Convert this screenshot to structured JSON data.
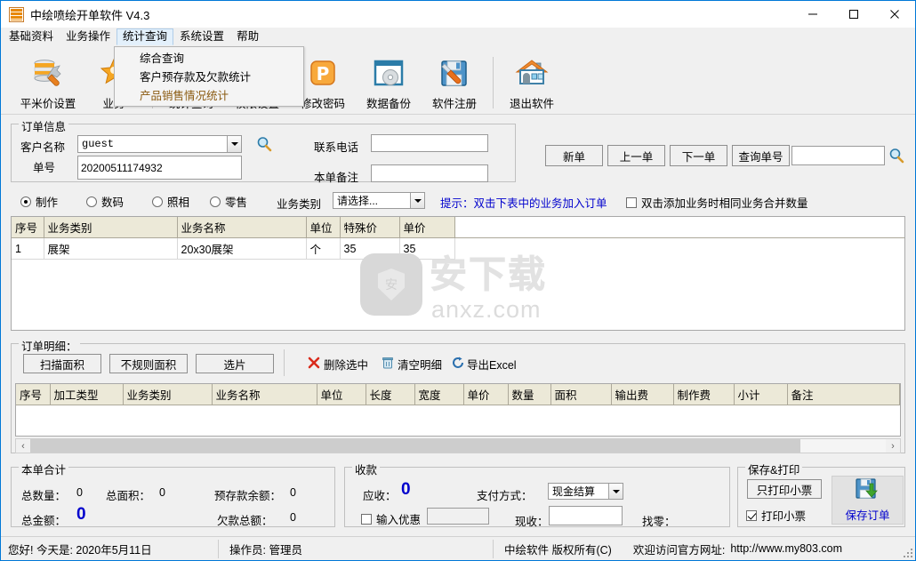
{
  "window": {
    "title": "中绘喷绘开单软件 V4.3",
    "icon": "app-icon",
    "minimize": "−",
    "maximize": "□",
    "close": "✕"
  },
  "menubar": {
    "items": [
      {
        "label": "基础资料",
        "active": false
      },
      {
        "label": "业务操作",
        "active": false
      },
      {
        "label": "统计查询",
        "active": true
      },
      {
        "label": "系统设置",
        "active": false
      },
      {
        "label": "帮助",
        "active": false
      }
    ]
  },
  "dropdown": {
    "open_for": "统计查询",
    "items": [
      {
        "label": "综合查询",
        "hover": false
      },
      {
        "label": "客户预存款及欠款统计",
        "hover": false
      },
      {
        "label": "产品销售情况统计",
        "hover": true
      }
    ]
  },
  "toolbar": {
    "buttons": [
      {
        "label": "平米价设置",
        "icon": "database-wrench-icon"
      },
      {
        "label": "业务",
        "icon": "star-user-icon"
      },
      {
        "label": "统计查询",
        "icon": "bar-pie-chart-icon"
      },
      {
        "label": "权限设置",
        "icon": "key-user-icon"
      },
      {
        "label": "修改密码",
        "icon": "password-p-icon"
      },
      {
        "label": "数据备份",
        "icon": "disc-backup-icon"
      },
      {
        "label": "软件注册",
        "icon": "floppy-screwdriver-icon"
      },
      {
        "label": "退出软件",
        "icon": "house-exit-icon"
      }
    ]
  },
  "order_info": {
    "legend": "订单信息",
    "customer_label": "客户名称",
    "customer_value": "guest",
    "customer_search_icon": "search-icon",
    "order_no_label": "单号",
    "order_no_value": "20200511174932",
    "phone_label": "联系电话",
    "phone_value": "",
    "remark_label": "本单备注",
    "remark_value": ""
  },
  "nav": {
    "new_order": "新单",
    "prev_order": "上一单",
    "next_order": "下一单",
    "query_order": "查询单号",
    "query_value": "",
    "query_search_icon": "search-icon"
  },
  "type_row": {
    "radios": [
      {
        "label": "制作",
        "checked": true
      },
      {
        "label": "数码",
        "checked": false
      },
      {
        "label": "照相",
        "checked": false
      },
      {
        "label": "零售",
        "checked": false
      }
    ],
    "category_label": "业务类别",
    "category_value": "请选择...",
    "hint": "提示：双击下表中的业务加入订单",
    "hint_color": "#0000cd",
    "merge_checkbox": {
      "label": "双击添加业务时相同业务合并数量",
      "checked": false
    }
  },
  "business_grid": {
    "columns": [
      "序号",
      "业务类别",
      "业务名称",
      "单位",
      "特殊价",
      "单价"
    ],
    "rows": [
      [
        "1",
        "展架",
        "20x30展架",
        "个",
        "35",
        "35"
      ]
    ]
  },
  "detail_section": {
    "legend": "订单明细：",
    "buttons": [
      {
        "label": "扫描面积"
      },
      {
        "label": "不规则面积"
      },
      {
        "label": "选片"
      }
    ],
    "actions": [
      {
        "label": "删除选中",
        "icon": "red-x-icon",
        "color": "#000000"
      },
      {
        "label": "清空明细",
        "icon": "trash-icon",
        "color": "#000000"
      },
      {
        "label": "导出Excel",
        "icon": "export-icon",
        "color": "#000000"
      }
    ],
    "columns": [
      "序号",
      "加工类型",
      "业务类别",
      "业务名称",
      "单位",
      "长度",
      "宽度",
      "单价",
      "数量",
      "面积",
      "输出费",
      "制作费",
      "小计",
      "备注"
    ],
    "rows": []
  },
  "totals": {
    "legend": "本单合计",
    "qty_label": "总数量：",
    "qty_value": "0",
    "area_label": "总面积：",
    "area_value": "0",
    "prepaid_label": "预存款余额：",
    "prepaid_value": "0",
    "amount_label": "总金额：",
    "amount_value": "0",
    "amount_color": "#0000cd",
    "debt_label": "欠款总额：",
    "debt_value": "0"
  },
  "payment": {
    "legend": "收款",
    "receivable_label": "应收：",
    "receivable_value": "0",
    "receivable_color": "#0000cd",
    "discount_checkbox": {
      "label": "输入优惠",
      "checked": false
    },
    "discount_value": "",
    "method_label": "支付方式：",
    "method_value": "现金结算",
    "received_label": "现收：",
    "received_value": "",
    "change_label": "找零：",
    "change_value": ""
  },
  "save_print": {
    "legend": "保存&打印",
    "print_only_button": "只打印小票",
    "print_checkbox": {
      "label": "打印小票",
      "checked": true
    },
    "save_button": "保存订单",
    "save_button_color": "#0000cd",
    "save_icon": "save-floppy-icon"
  },
  "statusbar": {
    "greeting": "您好! 今天是: 2020年5月11日",
    "operator": "操作员: 管理员",
    "copyright": "中绘软件 版权所有(C)",
    "website_label": "欢迎访问官方网址:",
    "website": "http://www.my803.com"
  },
  "watermark": {
    "cn": "安下载",
    "domain": "anxz.com",
    "badge_char": "安"
  }
}
